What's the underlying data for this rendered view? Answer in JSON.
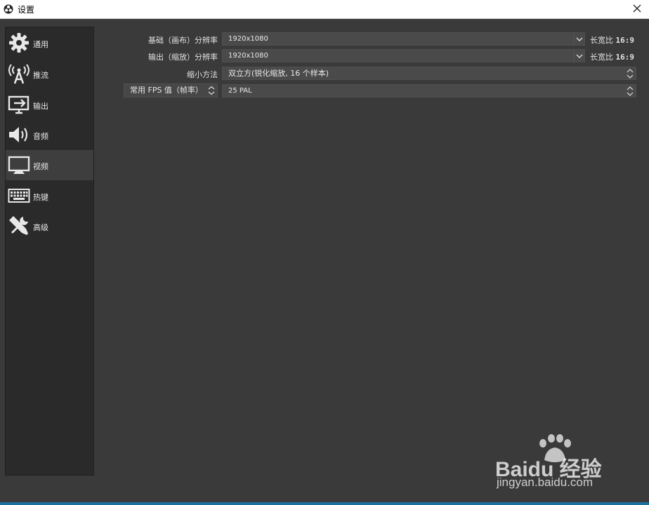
{
  "window": {
    "title": "设置",
    "close_icon": "close-icon",
    "app_icon": "obs-logo-icon"
  },
  "sidebar": {
    "items": [
      {
        "label": "通用",
        "icon": "gear-icon"
      },
      {
        "label": "推流",
        "icon": "broadcast-antenna-icon"
      },
      {
        "label": "输出",
        "icon": "monitor-output-icon"
      },
      {
        "label": "音频",
        "icon": "speaker-icon"
      },
      {
        "label": "视频",
        "icon": "monitor-icon",
        "active": true
      },
      {
        "label": "热键",
        "icon": "keyboard-icon"
      },
      {
        "label": "高级",
        "icon": "tools-icon"
      }
    ]
  },
  "video": {
    "base_resolution": {
      "label": "基础（画布）分辨率",
      "value": "1920x1080",
      "ratio_label": "长宽比",
      "ratio": "16:9"
    },
    "output_resolution": {
      "label": "输出（缩放）分辨率",
      "value": "1920x1080",
      "ratio_label": "长宽比",
      "ratio": "16:9"
    },
    "downscale_filter": {
      "label": "缩小方法",
      "value": "双立方(锐化缩放, 16 个样本)"
    },
    "fps": {
      "type_label": "常用 FPS 值（帧率）",
      "value": "25 PAL"
    }
  },
  "watermark": {
    "brand": "Baidu 经验",
    "domain": "jingyan.baidu.com"
  },
  "colors": {
    "background": "#3a3a3a",
    "sidebar": "#2a2a2a",
    "field": "#4a4a4a",
    "accent_bar": "#1f6f9e"
  }
}
